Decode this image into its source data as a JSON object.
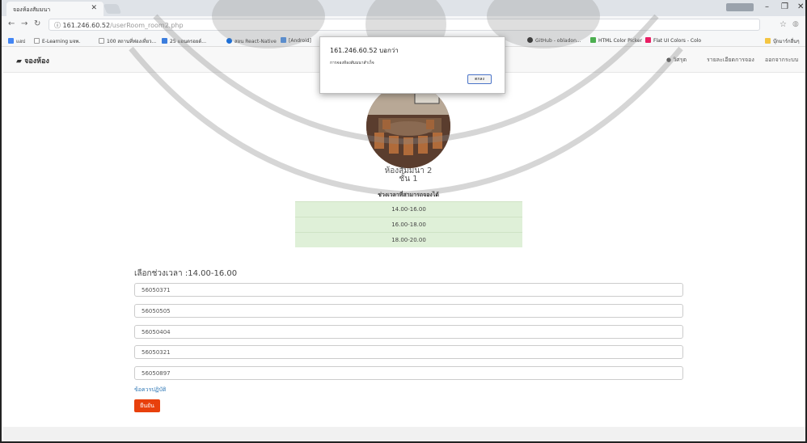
{
  "browser": {
    "tab_title": "จองห้องสัมมนา",
    "url_host": "161.246.60.52",
    "url_path": "/userRoom_room2.php",
    "bookmarks": [
      {
        "label": "แอป",
        "color": "#4285f4"
      },
      {
        "label": "E-Learning มจพ.",
        "color": "#ffffff"
      },
      {
        "label": "100 สถานที่ท่องเที่ยว...",
        "color": "#ffffff"
      },
      {
        "label": "25 แอนดรอยด์...",
        "color": "#3b7ddd"
      },
      {
        "label": "สอน React-Native",
        "color": "#1d6fd6"
      },
      {
        "label": "[Android]",
        "color": "#4a8fe7"
      },
      {
        "label": "GitHub - obladon...",
        "color": "#222222"
      },
      {
        "label": "HTML Color Picker",
        "color": "#4caf50"
      },
      {
        "label": "Flat UI Colors - Colo",
        "color": "#e91e63"
      },
      {
        "label": "บุ๊กมาร์กอื่นๆ",
        "color": "#f4c542"
      }
    ]
  },
  "app": {
    "brand": "จองห้อง",
    "nav": {
      "user": "วิศรุต",
      "booking_list": "รายละเอียดการจอง",
      "logout": "ออกจากระบบ"
    }
  },
  "room": {
    "name": "ห้องสัมมนา 2",
    "floor": "ชั้น 1",
    "slots_heading": "ช่วงเวลาที่สามารถจองได้",
    "slots": [
      "14.00-16.00",
      "16.00-18.00",
      "18.00-20.00"
    ]
  },
  "form": {
    "selected_label": "เลือกช่วงเวลา :",
    "selected_time": "14.00-16.00",
    "student_ids": [
      "56050371",
      "56050505",
      "56050404",
      "56050321",
      "56050897"
    ],
    "rules_link": "ข้อควรปฏิบัติ",
    "confirm_label": "ยืนยัน"
  },
  "alert": {
    "title": "161.246.60.52 บอกว่า",
    "message": "การจองห้องสัมมนาสำเร็จ",
    "ok_label": "ตกลง"
  }
}
